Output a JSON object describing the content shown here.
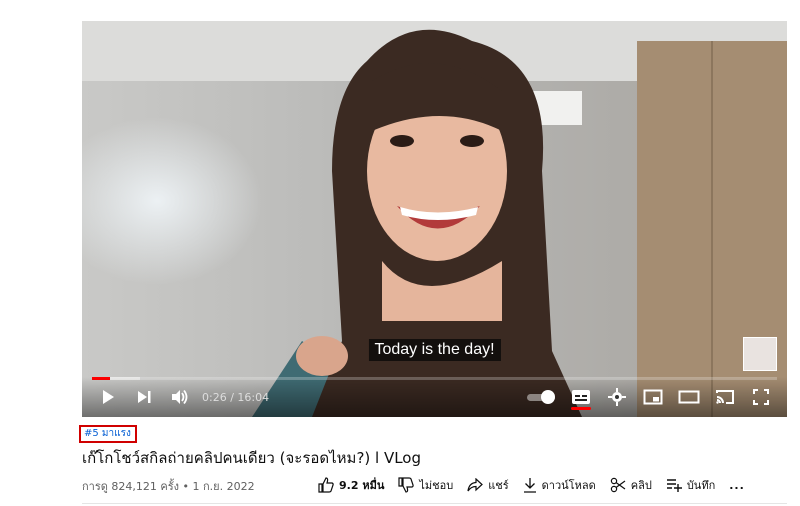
{
  "player": {
    "caption": "Today is the day!",
    "time": "0:26 / 16:04",
    "progress_played": 0.027,
    "progress_loaded": 0.07,
    "autoplay_on": true,
    "captions_on": true
  },
  "video": {
    "hashtag": "#5 มาแรง",
    "title": "เก๊โกโชว์สกิลถ่ายคลิปคนเดียว (จะรอดไหม?) l VLog",
    "meta": "การดู 824,121 ครั้ง • 1 ก.ย. 2022"
  },
  "actions": {
    "like_count": "9.2 หมื่น",
    "dislike_label": "ไม่ชอบ",
    "share_label": "แชร์",
    "download_label": "ดาวน์โหลด",
    "clip_label": "คลิป",
    "save_label": "บันทึก",
    "more_label": "..."
  },
  "colors": {
    "progress": "#ff0000",
    "link": "#065fd4",
    "highlight_box": "#d00000"
  }
}
